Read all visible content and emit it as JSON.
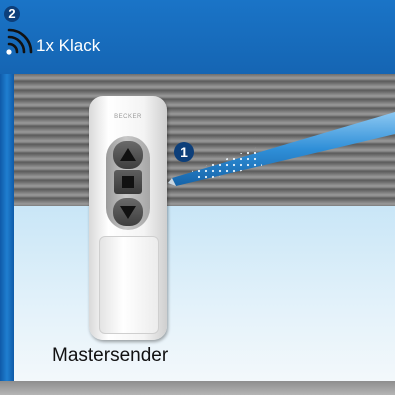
{
  "header": {
    "step_number": "2",
    "label": "1x Klack"
  },
  "remote": {
    "brand": "BECKER",
    "buttons": [
      "up",
      "stop",
      "down"
    ]
  },
  "step_marker": "1",
  "caption": "Mastersender",
  "icons": {
    "radio": "radio-signal-icon",
    "up": "arrow-up-icon",
    "stop": "stop-square-icon",
    "down": "arrow-down-icon"
  },
  "colors": {
    "header_blue": "#1a74c7",
    "badge_navy": "#0d3f7a",
    "pen_blue": "#2f8fd8"
  }
}
